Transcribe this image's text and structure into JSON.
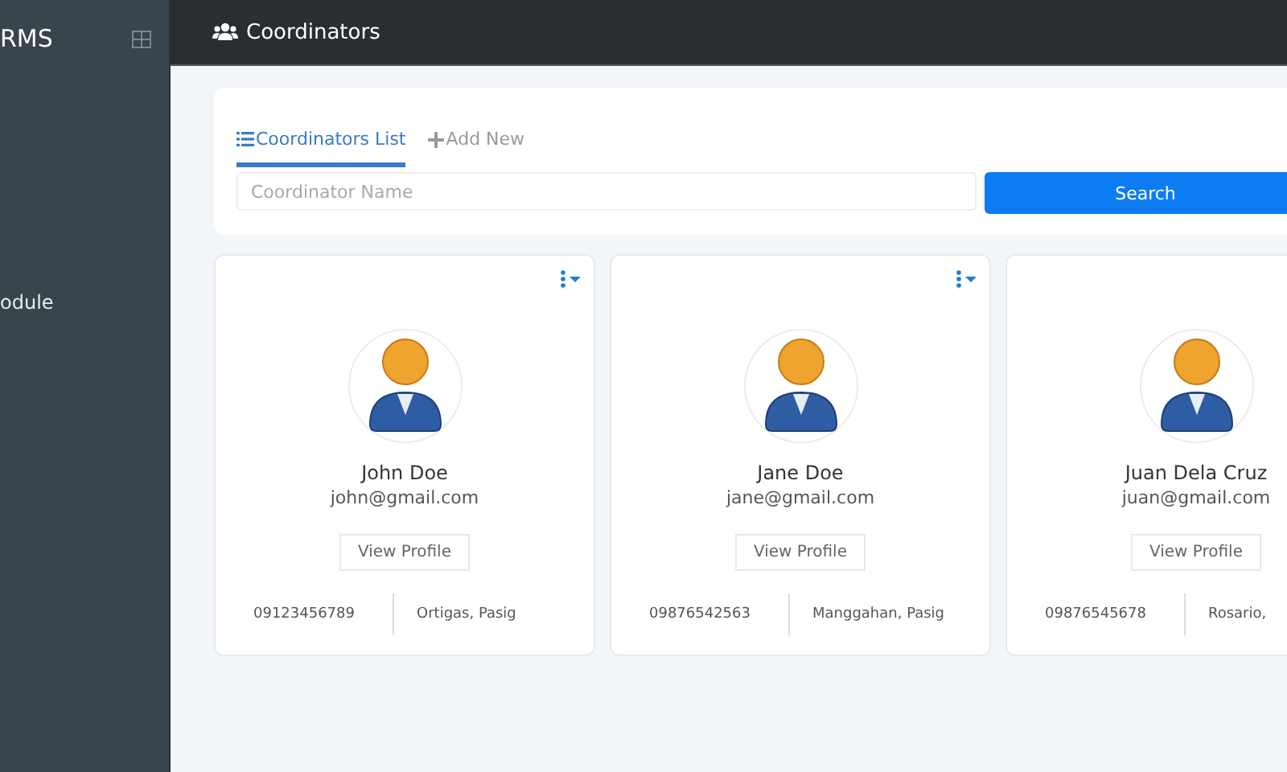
{
  "sidebar": {
    "brand": "RMS",
    "items": [
      "odule"
    ]
  },
  "header": {
    "title": "Coordinators"
  },
  "tabs": [
    {
      "label": "Coordinators List",
      "kind": "list",
      "selected": true
    },
    {
      "label": "Add New",
      "kind": "add",
      "selected": false
    }
  ],
  "search": {
    "placeholder": "Coordinator Name",
    "button": "Search"
  },
  "cards": [
    {
      "name": "John Doe",
      "email": "john@gmail.com",
      "button": "View Profile",
      "phone": "09123456789",
      "location": "Ortigas, Pasig"
    },
    {
      "name": "Jane Doe",
      "email": "jane@gmail.com",
      "button": "View Profile",
      "phone": "09876542563",
      "location": "Manggahan, Pasig"
    },
    {
      "name": "Juan Dela Cruz",
      "email": "juan@gmail.com",
      "button": "View Profile",
      "phone": "09876545678",
      "location": "Rosario,"
    }
  ]
}
